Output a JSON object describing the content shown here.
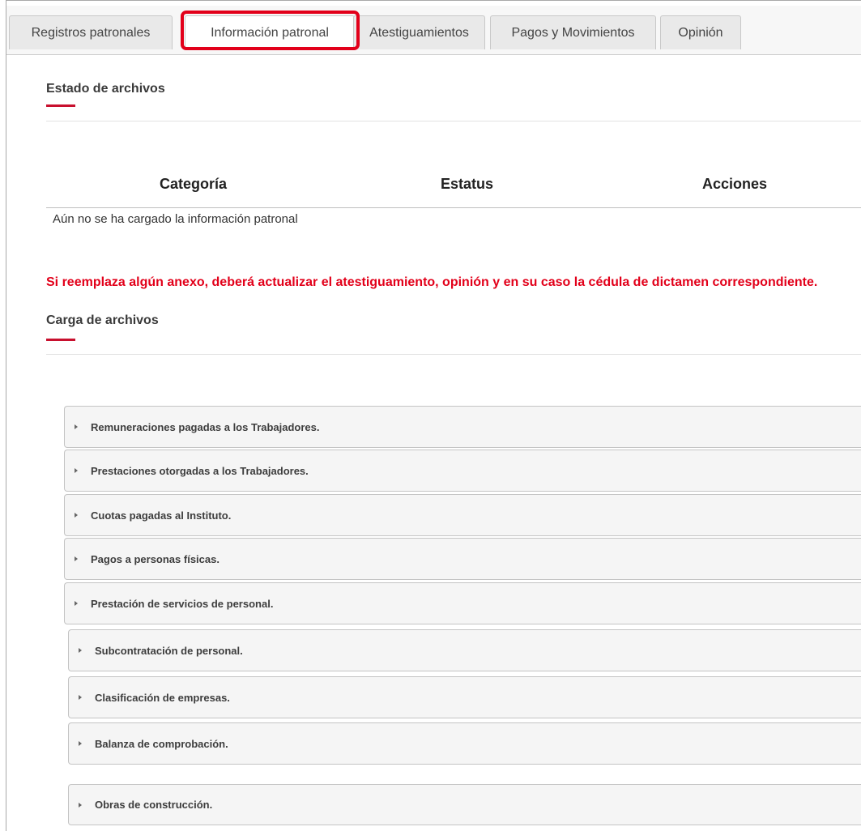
{
  "tabs": [
    {
      "label": "Registros patronales",
      "active": false
    },
    {
      "label": "Información patronal",
      "active": true
    },
    {
      "label": "Atestiguamientos",
      "active": false
    },
    {
      "label": "Pagos y Movimientos",
      "active": false
    },
    {
      "label": "Opinión",
      "active": false
    }
  ],
  "status_section": {
    "title": "Estado de archivos",
    "columns": [
      "Categoría",
      "Estatus",
      "Acciones"
    ],
    "empty_message": "Aún no se ha cargado la información patronal"
  },
  "warning": "Si reemplaza algún anexo, deberá actualizar el atestiguamiento, opinión y en su caso la cédula de dictamen correspondiente.",
  "upload_section": {
    "title": "Carga de archivos",
    "items": [
      "Remuneraciones pagadas a los Trabajadores.",
      "Prestaciones otorgadas a los Trabajadores.",
      "Cuotas pagadas al Instituto.",
      "Pagos a personas físicas.",
      "Prestación de servicios de personal.",
      "Subcontratación de personal.",
      "Clasificación de empresas.",
      "Balanza de comprobación.",
      "Obras de construcción."
    ]
  },
  "colors": {
    "accent_red": "#e2001a",
    "underline_red": "#c8102e",
    "tab_bg": "#e9e9e9",
    "accordion_bg": "#f5f5f5"
  },
  "icons": {
    "accordion_toggle": "caret-right-icon"
  }
}
